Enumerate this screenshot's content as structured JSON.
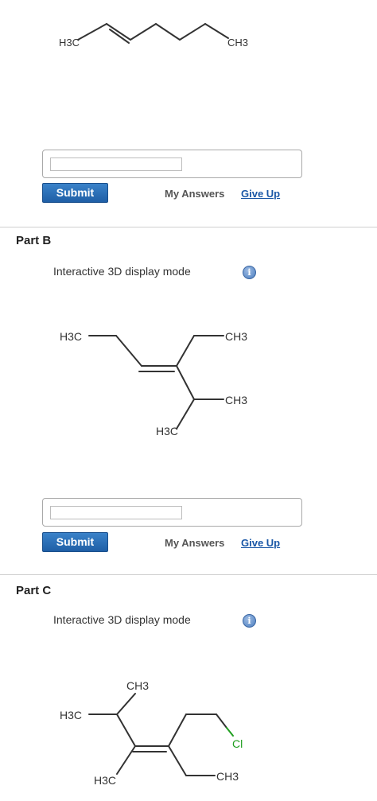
{
  "molecule_a": {
    "left_label": "H3C",
    "right_label": "CH3"
  },
  "part_a": {
    "answer_value": "",
    "submit_label": "Submit",
    "my_answers_label": "My Answers",
    "give_up_label": "Give Up"
  },
  "part_b": {
    "title": "Part B",
    "mode_label": "Interactive 3D display mode",
    "info_icon": "info-icon",
    "labels": {
      "h3c_top": "H3C",
      "ch3_upper": "CH3",
      "ch3_lower": "CH3",
      "h3c_bottom": "H3C"
    },
    "answer_value": "",
    "submit_label": "Submit",
    "my_answers_label": "My Answers",
    "give_up_label": "Give Up"
  },
  "part_c": {
    "title": "Part C",
    "mode_label": "Interactive 3D display mode",
    "info_icon": "info-icon",
    "labels": {
      "ch3_top": "CH3",
      "h3c_left": "H3C",
      "cl": "Cl",
      "h3c_bottom": "H3C",
      "ch3_bottom": "CH3"
    }
  },
  "colors": {
    "chlorine": "#1f9e1f",
    "link": "#1a57a6",
    "button": "#2a6fb8"
  }
}
